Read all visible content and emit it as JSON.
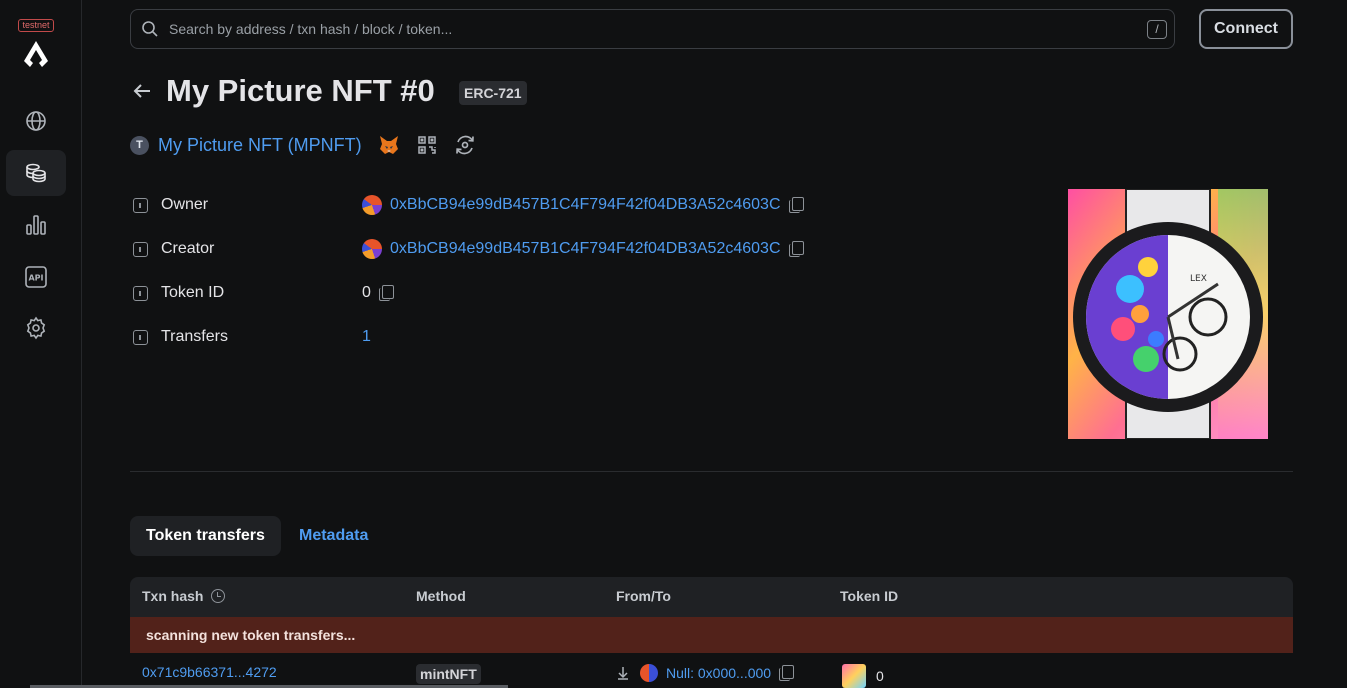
{
  "sidebar": {
    "env_badge": "testnet",
    "logo_icon": "lisk-logo-icon",
    "items": [
      {
        "name": "blockchain",
        "icon": "globe-icon",
        "active": false
      },
      {
        "name": "tokens",
        "icon": "coins-icon",
        "active": true
      },
      {
        "name": "charts",
        "icon": "bar-chart-icon",
        "active": false
      },
      {
        "name": "api",
        "icon": "api-icon",
        "active": false
      },
      {
        "name": "settings",
        "icon": "gear-icon",
        "active": false
      }
    ]
  },
  "search": {
    "placeholder": "Search by address / txn hash / block / token...",
    "shortcut_key": "/"
  },
  "header": {
    "connect_label": "Connect",
    "title": "My Picture NFT #0",
    "token_type": "ERC-721",
    "collection_initial": "T",
    "collection_name": "My Picture NFT (MPNFT)"
  },
  "details": {
    "owner_label": "Owner",
    "owner_address": "0xBbCB94e99dB457B1C4F794F42f04DB3A52c4603C",
    "creator_label": "Creator",
    "creator_address": "0xBbCB94e99dB457B1C4F794F42f04DB3A52c4603C",
    "token_id_label": "Token ID",
    "token_id_value": "0",
    "transfers_label": "Transfers",
    "transfers_value": "1"
  },
  "tabs": [
    {
      "label": "Token transfers",
      "active": true
    },
    {
      "label": "Metadata",
      "active": false
    }
  ],
  "table": {
    "columns": [
      "Txn hash",
      "Method",
      "From/To",
      "Token ID"
    ],
    "notice": "scanning new token transfers...",
    "rows": [
      {
        "txn_hash": "0x71c9b66371...4272",
        "method": "mintNFT",
        "from": "Null: 0x000...000",
        "token_id": "0"
      }
    ]
  },
  "colors": {
    "accent_link": "#4f9cf0",
    "background": "#101112",
    "notice_bg": "#52221a"
  }
}
